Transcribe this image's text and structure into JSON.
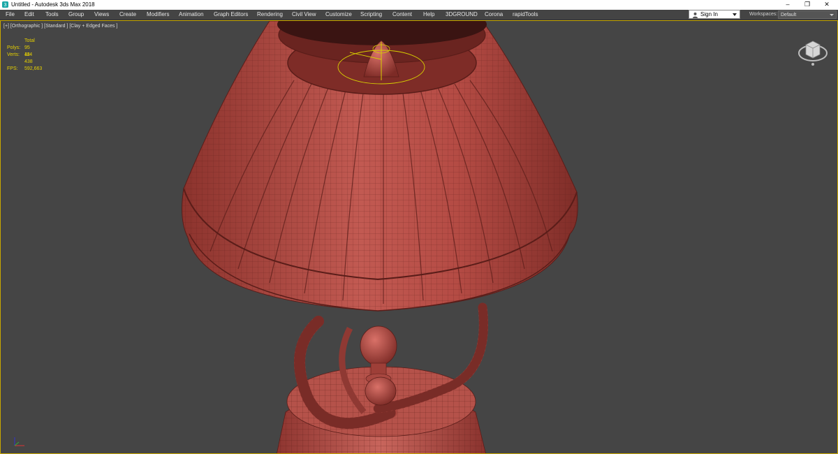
{
  "window": {
    "title": "Untitled - Autodesk 3ds Max 2018",
    "controls": [
      "–",
      "❐",
      "✕"
    ]
  },
  "menu": [
    {
      "label": "File"
    },
    {
      "label": "Edit"
    },
    {
      "label": "Tools"
    },
    {
      "label": "Group"
    },
    {
      "label": "Views"
    },
    {
      "label": "Create"
    },
    {
      "label": "Modifiers"
    },
    {
      "label": "Animation"
    },
    {
      "label": "Graph Editors"
    },
    {
      "label": "Rendering"
    },
    {
      "label": "Civil View"
    },
    {
      "label": "Customize"
    },
    {
      "label": "Scripting"
    },
    {
      "label": "Content"
    },
    {
      "label": "Help"
    },
    {
      "label": "3DGROUND"
    },
    {
      "label": "Corona"
    },
    {
      "label": "rapidTools"
    }
  ],
  "signin": {
    "label": "Sign In"
  },
  "workspaces": {
    "label": "Workspaces:",
    "value": "Default"
  },
  "viewport": {
    "label": "[+] [Orthographic ] [Standard ] [Clay + Edged Faces ]",
    "stats": {
      "header": "Total",
      "polys_label": "Polys:",
      "polys_value": "95 114",
      "verts_label": "Verts:",
      "verts_value": "48 438",
      "fps_label": "FPS:",
      "fps_value": "592,663"
    }
  },
  "icons": {
    "app": "3dsmax-app-icon",
    "user": "user-icon",
    "viewcube": "viewcube-icon",
    "axis": "axis-tripod-icon"
  },
  "colors": {
    "clay": "#b94c45",
    "clay_dark": "#7a2a25",
    "viewport_bg": "#454545",
    "active_border": "#c9a800",
    "stats_text": "#e6d000"
  }
}
